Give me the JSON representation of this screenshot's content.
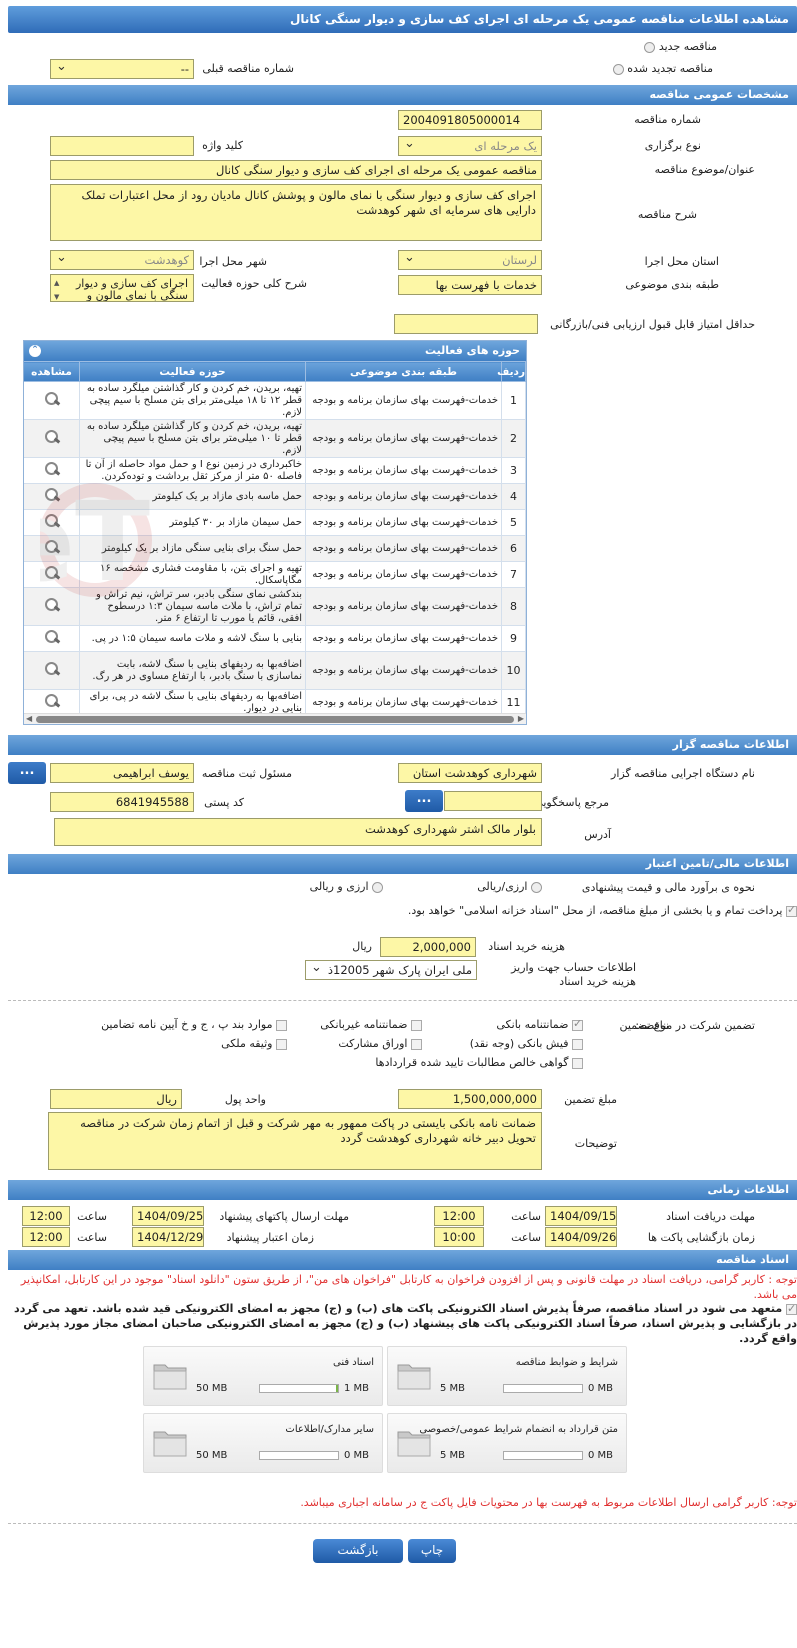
{
  "page_title": "مشاهده اطلاعات مناقصه عمومی یک مرحله ای اجرای کف سازی و دیوار سنگی کانال",
  "top": {
    "radio_new": "مناقصه جدید",
    "radio_renewed": "مناقصه تجدید شده",
    "prev_number_label": "شماره مناقصه قبلی",
    "prev_number_value": "--"
  },
  "general": {
    "header": "مشخصات عمومی مناقصه",
    "number_label": "شماره مناقصه",
    "number_value": "2004091805000014",
    "type_label": "نوع برگزاری",
    "type_value": "یک مرحله ای",
    "keyword_label": "کلید واژه",
    "keyword_value": "",
    "subject_label": "عنوان/موضوع مناقصه",
    "subject_value": "مناقصه عمومی یک مرحله ای اجرای کف سازی و دیوار سنگی کانال",
    "desc_label": "شرح مناقصه",
    "desc_value": "اجرای کف سازی و دیوار سنگی با نمای مالون و پوشش کانال مادیان رود از محل اعتبارات تملک دارایی های سرمایه ای شهر کوهدشت",
    "province_label": "استان محل اجرا",
    "province_value": "لرستان",
    "city_label": "شهر محل اجرا",
    "city_value": "کوهدشت",
    "category_label": "طبقه بندی موضوعی",
    "category_value": "خدمات با فهرست بها",
    "activity_label": "شرح کلی حوزه فعالیت",
    "activity_value": "اجرای کف سازی و دیوار سنگی با نمای مالون و",
    "min_score_label": "حداقل امتیاز قابل قبول ارزیابی فنی/بازرگانی",
    "min_score_value": ""
  },
  "activities": {
    "header": "حوزه های فعالیت",
    "col_row": "ردیف",
    "col_category": "طبقه بندی موضوعی",
    "col_activity": "حوزه فعالیت",
    "col_view": "مشاهده",
    "rows": [
      {
        "n": "1",
        "cat": "خدمات-فهرست بهای سازمان برنامه و بودجه",
        "act": "تهیه، بریدن، خم کردن و کار گذاشتن میلگرد ساده به قطر ۱۲ تا ۱۸ میلی‌متر برای بتن مسلح با سیم پیچی لازم."
      },
      {
        "n": "2",
        "cat": "خدمات-فهرست بهای سازمان برنامه و بودجه",
        "act": "تهیه، بریدن، خم کردن و کار گذاشتن میلگرد ساده به قطر تا ۱۰ میلی‌متر برای بتن مسلح با سیم پیچی لازم."
      },
      {
        "n": "3",
        "cat": "خدمات-فهرست بهای سازمان برنامه و بودجه",
        "act": "خاکبرداری در زمین نوع I و حمل مواد حاصله از آن تا فاصله ۵۰ متر از مرکز ثقل برداشت و توده‌کردن."
      },
      {
        "n": "4",
        "cat": "خدمات-فهرست بهای سازمان برنامه و بودجه",
        "act": "حمل ماسه بادی مازاد بر یک کیلومتر"
      },
      {
        "n": "5",
        "cat": "خدمات-فهرست بهای سازمان برنامه و بودجه",
        "act": "حمل سیمان مازاد بر ۳۰ کیلومتر"
      },
      {
        "n": "6",
        "cat": "خدمات-فهرست بهای سازمان برنامه و بودجه",
        "act": "حمل سنگ برای بنایی سنگی مازاد بر یک کیلومتر"
      },
      {
        "n": "7",
        "cat": "خدمات-فهرست بهای سازمان برنامه و بودجه",
        "act": "تهیه و اجرای بتن، با مقاومت فشاری مشخصه ۱۶ مگاپاسکال."
      },
      {
        "n": "8",
        "cat": "خدمات-فهرست بهای سازمان برنامه و بودجه",
        "act": "بندکشی نمای سنگی بادبر، سر تراش، نیم تراش و تمام تراش، با ملات ماسه سیمان ۱:۳ درسطوح افقی، قائم یا مورب تا ارتفاع ۶ متر."
      },
      {
        "n": "9",
        "cat": "خدمات-فهرست بهای سازمان برنامه و بودجه",
        "act": "بنایی با سنگ لاشه و ملات ماسه سیمان ۱:۵ در پی."
      },
      {
        "n": "10",
        "cat": "خدمات-فهرست بهای سازمان برنامه و بودجه",
        "act": "اضافه‌بها به ردیفهای بنایی با سنگ لاشه، بابت نماسازی با سنگ بادبر، با ارتفاع مساوی در هر رگ."
      },
      {
        "n": "11",
        "cat": "خدمات-فهرست بهای سازمان برنامه و بودجه",
        "act": "اضافه‌بها به ردیفهای بنایی با سنگ لاشه در پی، برای بنایی در دیوار."
      }
    ]
  },
  "organizer": {
    "header": "اطلاعات مناقصه گزار",
    "org_label": "نام دستگاه اجرایی مناقصه گزار",
    "org_value": "شهرداری کوهدشت استان",
    "registrar_label": "مسئول ثبت مناقصه",
    "registrar_value": "یوسف ابراهیمی",
    "responder_label": "مرجع پاسخگویی",
    "responder_value": "",
    "postal_label": "کد پستی",
    "postal_value": "6841945588",
    "address_label": "آدرس",
    "address_value": "بلوار مالک اشتر شهرداری کوهدشت",
    "dots": "..."
  },
  "finance": {
    "header": "اطلاعات مالی/تامین اعتبار",
    "estimate_label": "نحوه ی برآورد مالی و قیمت پیشنهادی",
    "opt_rial": "ارزی/ریالی",
    "opt_fx": "ارزی و ریالی",
    "treasury_text": "پرداخت تمام و یا بخشی از مبلغ مناقصه، از محل \"اسناد خزانه اسلامی\" خواهد بود.",
    "doc_fee_label": "هزینه خرید اسناد",
    "doc_fee_value": "2,000,000",
    "doc_fee_unit": "ریال",
    "account_label": "اطلاعات حساب جهت واریز هزینه خرید اسناد",
    "account_value": "ملی ایران پارک شهر 12005ذ"
  },
  "guarantee": {
    "section_label": "تضمین شرکت در مناقصه:",
    "type_label": "نوع تضمین",
    "opt_bank": "ضمانتنامه بانکی",
    "opt_nonbank": "ضمانتنامه غیربانکی",
    "opt_items": "موارد بند پ ، ج و خ آیین نامه تضامین",
    "opt_cash": "فیش بانکی (وجه نقد)",
    "opt_bonds": "اوراق مشارکت",
    "opt_property": "وثیقه ملکی",
    "opt_claims": "گواهی خالص مطالبات تایید شده قراردادها",
    "amount_label": "مبلغ تضمین",
    "amount_value": "1,500,000,000",
    "currency_label": "واحد پول",
    "currency_value": "ریال",
    "notes_label": "توضیحات",
    "notes_value": "ضمانت نامه بانکی بایستی در پاکت ممهور به مهر شرکت و قبل از اتمام زمان شرکت در مناقصه تحویل دبیر خانه شهرداری کوهدشت گردد"
  },
  "timing": {
    "header": "اطلاعات زمانی",
    "receive_label": "مهلت دریافت اسناد",
    "receive_date": "1404/09/15",
    "receive_time": "12:00",
    "submit_label": "مهلت ارسال پاکتهای پیشنهاد",
    "submit_date": "1404/09/25",
    "submit_time": "12:00",
    "open_label": "زمان بازگشایی پاکت ها",
    "open_date": "1404/09/26",
    "open_time": "10:00",
    "validity_label": "زمان اعتبار پیشنهاد",
    "validity_date": "1404/12/29",
    "validity_time": "12:00",
    "time_label": "ساعت"
  },
  "documents": {
    "header": "اسناد مناقصه",
    "note": "توجه : کاربر گرامی، دریافت اسناد در مهلت قانونی و پس از افزودن فراخوان به کارتابل \"فراخوان های من\"، از طریق ستون \"دانلود اسناد\" موجود در این کارتابل، امکانپذیر می باشد.",
    "commit": "متعهد می شود در اسناد مناقصه، صرفاً پذیرش اسناد الکترونیکی پاکت های (ب) و (ج) مجهز به امضای الکترونیکی قید شده باشد. تعهد می گردد در بازگشایی و پذیرش اسناد، صرفاً اسناد الکترونیکی پاکت های پیشنهاد (ب) و (ج) مجهز به امضای الکترونیکی صاحبان امضای مجاز مورد پذیرش واقع گردد.",
    "files": [
      {
        "name": "شرایط و ضوابط مناقصه",
        "current": "0 MB",
        "max": "5 MB",
        "pct": 0
      },
      {
        "name": "اسناد فنی",
        "current": "1 MB",
        "max": "50 MB",
        "pct": 2
      },
      {
        "name": "متن قرارداد به انضمام شرایط عمومی/خصوصی",
        "current": "0 MB",
        "max": "5 MB",
        "pct": 0
      },
      {
        "name": "سایر مدارک/اطلاعات",
        "current": "0 MB",
        "max": "50 MB",
        "pct": 0
      }
    ],
    "bottom_note": "توجه: کاربر گرامی ارسال اطلاعات مربوط به فهرست بها در محتویات فایل پاکت ج در سامانه اجباری میباشد."
  },
  "buttons": {
    "print": "چاپ",
    "back": "بازگشت"
  },
  "watermark_text": "AriaTender.neT"
}
